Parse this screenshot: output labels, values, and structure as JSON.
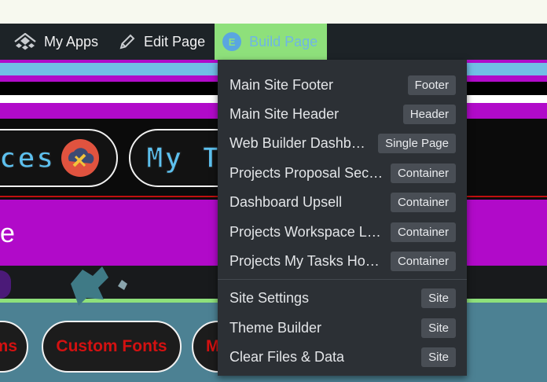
{
  "admin_bar": {
    "items": [
      {
        "label": "My Apps",
        "icon": "apps-house-icon"
      },
      {
        "label": "Edit Page",
        "icon": "pencil-icon"
      },
      {
        "label": "Build Page",
        "icon": "elementor-logo-icon"
      }
    ]
  },
  "background": {
    "pill_1_text": "ces",
    "pill_2_text": "My T",
    "banner_text": "e",
    "buttons": [
      "ms",
      "Custom Fonts",
      "M"
    ]
  },
  "dropdown": {
    "templates": [
      {
        "label": "Main Site Footer",
        "badge": "Footer"
      },
      {
        "label": "Main Site Header",
        "badge": "Header"
      },
      {
        "label": "Web Builder Dashboard",
        "badge": "Single Page"
      },
      {
        "label": "Projects Proposal Section",
        "badge": "Container"
      },
      {
        "label": "Dashboard Upsell",
        "badge": "Container"
      },
      {
        "label": "Projects Workspace Layout",
        "badge": "Container"
      },
      {
        "label": "Projects My Tasks Home",
        "badge": "Container"
      }
    ],
    "site": [
      {
        "label": "Site Settings",
        "badge": "Site"
      },
      {
        "label": "Theme Builder",
        "badge": "Site"
      },
      {
        "label": "Clear Files & Data",
        "badge": "Site"
      }
    ]
  },
  "colors": {
    "admin_bar_bg": "#1d2327",
    "active_tab_bg": "#8ee07b",
    "active_tab_text": "#6fb5e6",
    "menu_bg": "#2c3035",
    "badge_bg": "#494e55",
    "page_magenta": "#b10ac9",
    "page_sky": "#72bde5"
  }
}
